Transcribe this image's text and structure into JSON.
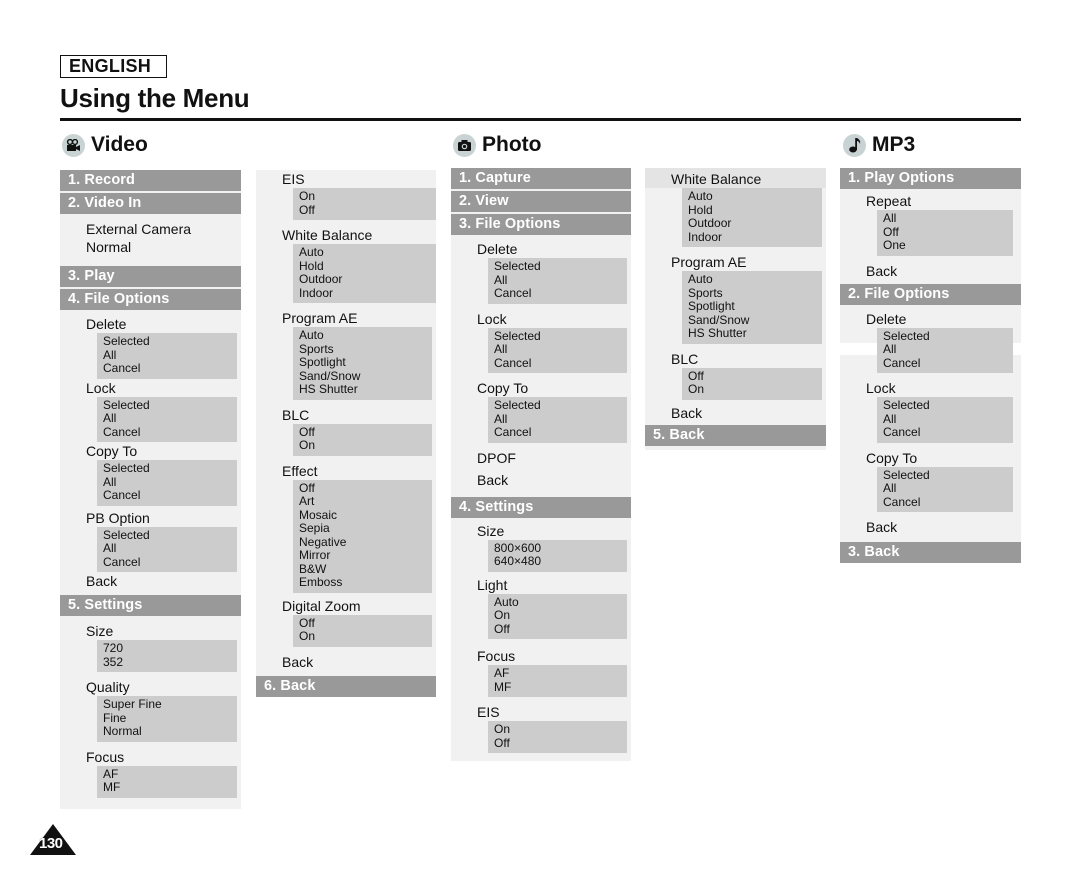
{
  "header": {
    "language": "ENGLISH",
    "title": "Using the Menu"
  },
  "sections": {
    "video": {
      "title": "Video",
      "icon": "video-camera-icon"
    },
    "photo": {
      "title": "Photo",
      "icon": "camera-icon"
    },
    "mp3": {
      "title": "MP3",
      "icon": "music-note-icon"
    }
  },
  "video": {
    "record": "1. Record",
    "video_in": "2. Video In",
    "video_in_items": [
      "External Camera",
      "Normal"
    ],
    "play": "3. Play",
    "file_options": "4. File Options",
    "delete": "Delete",
    "delete_opts": [
      "Selected",
      "All",
      "Cancel"
    ],
    "lock": "Lock",
    "lock_opts": [
      "Selected",
      "All",
      "Cancel"
    ],
    "copy_to": "Copy To",
    "copy_opts": [
      "Selected",
      "All",
      "Cancel"
    ],
    "pb_option": "PB Option",
    "pb_opts": [
      "Selected",
      "All",
      "Cancel"
    ],
    "file_back": "Back",
    "settings": "5. Settings",
    "size": "Size",
    "size_opts": [
      "720",
      "352"
    ],
    "quality": "Quality",
    "quality_opts": [
      "Super Fine",
      "Fine",
      "Normal"
    ],
    "focus": "Focus",
    "focus_opts": [
      "AF",
      "MF"
    ],
    "eis": "EIS",
    "eis_opts": [
      "On",
      "Off"
    ],
    "wb": "White Balance",
    "wb_opts": [
      "Auto",
      "Hold",
      "Outdoor",
      "Indoor"
    ],
    "program_ae": "Program AE",
    "ae_opts": [
      "Auto",
      "Sports",
      "Spotlight",
      "Sand/Snow",
      "HS Shutter"
    ],
    "blc": "BLC",
    "blc_opts": [
      "Off",
      "On"
    ],
    "effect": "Effect",
    "effect_opts": [
      "Off",
      "Art",
      "Mosaic",
      "Sepia",
      "Negative",
      "Mirror",
      "B&W",
      "Emboss"
    ],
    "digital_zoom": "Digital Zoom",
    "dz_opts": [
      "Off",
      "On"
    ],
    "settings_back": "Back",
    "back": "6. Back"
  },
  "photo": {
    "capture": "1. Capture",
    "view": "2. View",
    "file_options": "3. File Options",
    "delete": "Delete",
    "delete_opts": [
      "Selected",
      "All",
      "Cancel"
    ],
    "lock": "Lock",
    "lock_opts": [
      "Selected",
      "All",
      "Cancel"
    ],
    "copy_to": "Copy To",
    "copy_opts": [
      "Selected",
      "All",
      "Cancel"
    ],
    "dpof": "DPOF",
    "file_back": "Back",
    "settings": "4. Settings",
    "size": "Size",
    "size_opts": [
      "800×600",
      "640×480"
    ],
    "light": "Light",
    "light_opts": [
      "Auto",
      "On",
      "Off"
    ],
    "focus": "Focus",
    "focus_opts": [
      "AF",
      "MF"
    ],
    "eis": "EIS",
    "eis_opts": [
      "On",
      "Off"
    ],
    "wb": "White Balance",
    "wb_opts": [
      "Auto",
      "Hold",
      "Outdoor",
      "Indoor"
    ],
    "program_ae": "Program AE",
    "ae_opts": [
      "Auto",
      "Sports",
      "Spotlight",
      "Sand/Snow",
      "HS Shutter"
    ],
    "blc": "BLC",
    "blc_opts": [
      "Off",
      "On"
    ],
    "settings_back": "Back",
    "back": "5. Back"
  },
  "mp3": {
    "play_options": "1. Play Options",
    "repeat": "Repeat",
    "repeat_opts": [
      "All",
      "Off",
      "One"
    ],
    "play_back": "Back",
    "file_options": "2. File Options",
    "delete": "Delete",
    "delete_opts": [
      "Selected",
      "All",
      "Cancel"
    ],
    "lock": "Lock",
    "lock_opts": [
      "Selected",
      "All",
      "Cancel"
    ],
    "copy_to": "Copy To",
    "copy_opts": [
      "Selected",
      "All",
      "Cancel"
    ],
    "file_back": "Back",
    "back": "3. Back"
  },
  "footer": {
    "page_number": "130"
  }
}
